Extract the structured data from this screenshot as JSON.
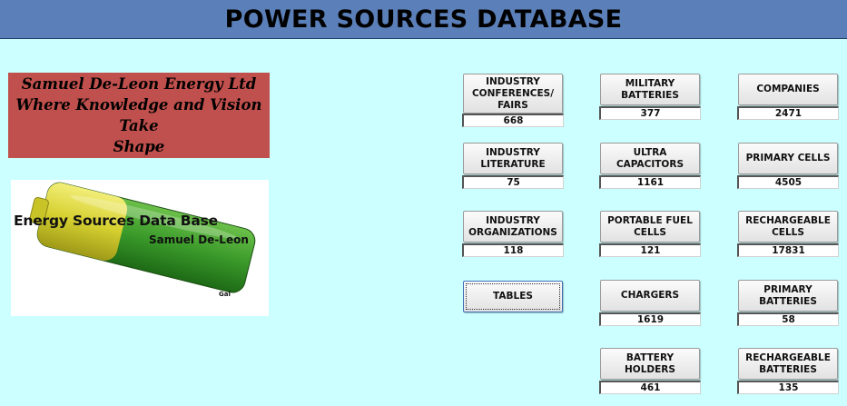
{
  "header": {
    "title": "POWER SOURCES DATABASE"
  },
  "company": {
    "line1": "Samuel De-Leon Energy Ltd",
    "line2": "Where Knowledge and Vision Take",
    "line3": "Shape"
  },
  "logo": {
    "title": "Energy Sources Data Base",
    "subtitle": "Samuel De-Leon",
    "mark": "Gal"
  },
  "buttons": {
    "industry_conferences": {
      "label": "INDUSTRY CONFERENCES/ FAIRS",
      "count": "668"
    },
    "industry_literature": {
      "label": "INDUSTRY LITERATURE",
      "count": "75"
    },
    "industry_organizations": {
      "label": "INDUSTRY ORGANIZATIONS",
      "count": "118"
    },
    "tables": {
      "label": "TABLES"
    },
    "military_batteries": {
      "label": "MILITARY BATTERIES",
      "count": "377"
    },
    "ultra_capacitors": {
      "label": "ULTRA CAPACITORS",
      "count": "1161"
    },
    "portable_fuel_cells": {
      "label": "PORTABLE FUEL CELLS",
      "count": "121"
    },
    "chargers": {
      "label": "CHARGERS",
      "count": "1619"
    },
    "battery_holders": {
      "label": "BATTERY HOLDERS",
      "count": "461"
    },
    "companies": {
      "label": "COMPANIES",
      "count": "2471"
    },
    "primary_cells": {
      "label": "PRIMARY CELLS",
      "count": "4505"
    },
    "rechargeable_cells": {
      "label": "RECHARGEABLE CELLS",
      "count": "17831"
    },
    "primary_batteries": {
      "label": "PRIMARY BATTERIES",
      "count": "58"
    },
    "rechargeable_batteries": {
      "label": "RECHARGEABLE BATTERIES",
      "count": "135"
    }
  },
  "colors": {
    "background": "#ccffff",
    "header": "#5b7fb8",
    "company_banner": "#c0504d",
    "battery_green": "#3a9a2a",
    "battery_yellow": "#d6d030"
  }
}
